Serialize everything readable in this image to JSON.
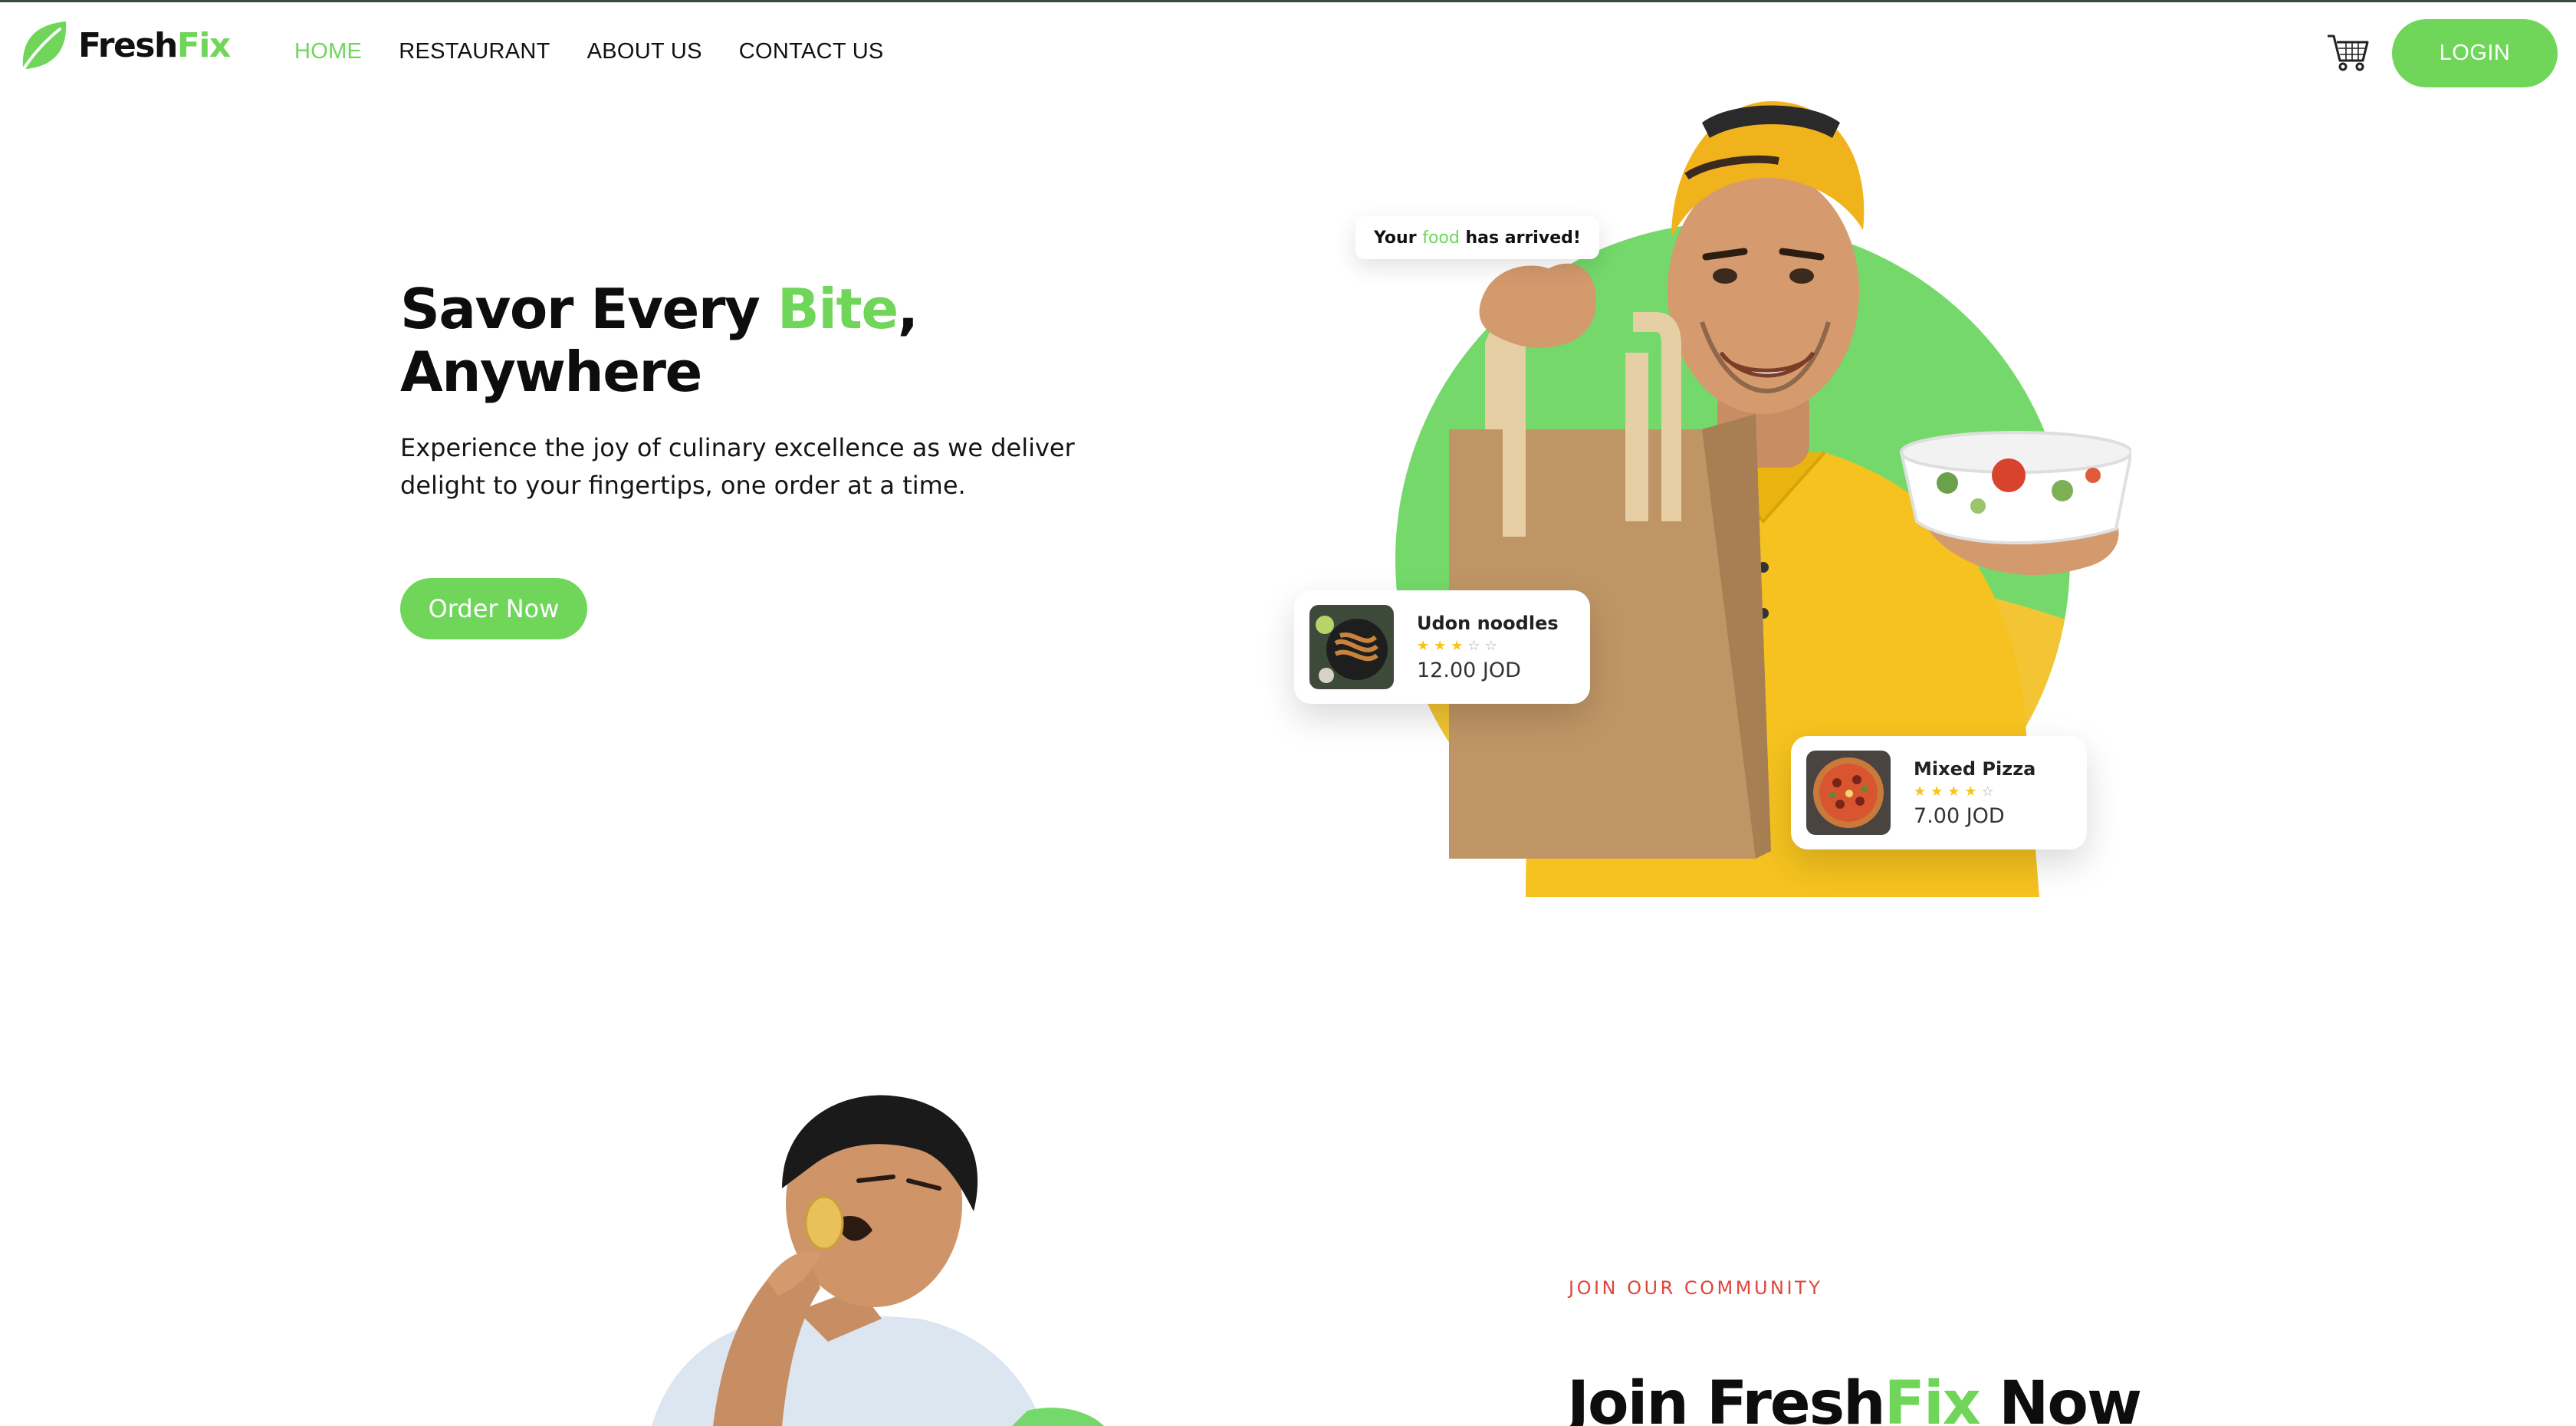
{
  "brand": {
    "name_part1": "Fresh",
    "name_part2": "Fix",
    "accent": "#6fd65a",
    "icon": "leaf-icon"
  },
  "nav": {
    "links": [
      {
        "label": "HOME",
        "active": true
      },
      {
        "label": "RESTAURANT",
        "active": false
      },
      {
        "label": "ABOUT US",
        "active": false
      },
      {
        "label": "CONTACT US",
        "active": false
      }
    ],
    "cart_icon": "cart-icon",
    "login_label": "LOGIN"
  },
  "hero": {
    "title_part1": "Savor Every ",
    "title_highlight": "Bite",
    "title_part2": ",",
    "title_line2": "Anywhere",
    "subtitle": "Experience the joy of culinary excellence as we deliver delight to your fingertips, one order at a time.",
    "cta_label": "Order Now",
    "toast_part1": "Your ",
    "toast_highlight": "food",
    "toast_part2": " has arrived!"
  },
  "food_cards": [
    {
      "name": "Udon noodles",
      "rating": 3,
      "max_rating": 5,
      "price": "12.00 JOD"
    },
    {
      "name": "Mixed Pizza",
      "rating": 4,
      "max_rating": 5,
      "price": "7.00 JOD"
    }
  ],
  "community": {
    "kicker": "JOIN OUR COMMUNITY",
    "title_part1": "Join ",
    "title_brand1": "Fresh",
    "title_brand2": "Fix",
    "title_part2": " Now"
  },
  "colors": {
    "accent_green": "#6fd65a",
    "yellow": "#f3c534",
    "kicker_red": "#e2453a"
  }
}
